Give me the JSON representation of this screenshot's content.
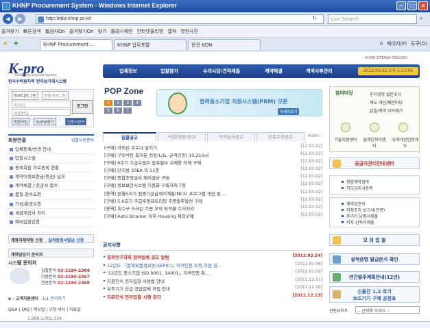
{
  "window": {
    "title": "KHNP Procurement System - Windows Internet Explorer"
  },
  "browser": {
    "url": "http://ebiz.khnp.co.kr/",
    "search_placeholder": "Live Search",
    "favorites": [
      "즐겨찾기",
      "빠른검색",
      "웹검사On",
      "즐겨찾기On",
      "찾기",
      "플래시제한",
      "인터넷올리빙",
      "캡쳐",
      "영한사전"
    ],
    "tabs": [
      "KHNP Procurement ...",
      "KHNP 업무포탈",
      "한전 KDN"
    ],
    "tools": [
      "페이지(P)",
      "도구(O)"
    ]
  },
  "header": {
    "logo": "K-pro",
    "logo_sub": "KHNP Procurement System",
    "logo_sub2": "한국수력원자력 전자상거래시스템",
    "top_links": "HOME  SITEMAP  ENGLISH",
    "gnb": [
      "업체정보",
      "입찰참가",
      "수의시담/견적제출",
      "계약체결",
      "계약사후관리"
    ],
    "clock": "2012.03.02  오후 5:57:06"
  },
  "login": {
    "tab_id": "아이디로그인",
    "tab_cert": "인증서로그인",
    "id_placeholder": "아이디",
    "pw_placeholder": "비밀번호",
    "login_button": "로그인",
    "member_join": "회원가입",
    "find_idpw": "ID/PW찾기",
    "cert_login": "인증서관리"
  },
  "quicklinks": {
    "title": "회원연결",
    "subtitle": "입찰사전준비",
    "items": [
      "업체등록/변경 안내",
      "입찰시스템",
      "등록회원 자료등록 현황",
      "계약이행보증금(증권) 납부",
      "계약체결 / 준공서 접수",
      "품질 검수요청",
      "기성/준공요청",
      "세금계산서 처리",
      "예비입찰신청"
    ]
  },
  "left_buttons": {
    "b1": "계좌이체약정 신청",
    "b1b": "실적증명서발급 신청",
    "b2": "계약담당자 문의처"
  },
  "contact": {
    "title": "시스템 문의처",
    "r1_label": "입찰문의",
    "r1_tel": "02-2194-2384",
    "r2_label": "이용문의",
    "r2_tel": "02-2194-2367",
    "r3_label": "전산문의",
    "r3_tel": "02-2194-2368",
    "center": "e - 고객지원센터",
    "center2": "1:1 문의하기",
    "faq": "Q&A | FAQ | 매뉴얼 | 규정·서식 | 자료실",
    "counts": "1,998     1,002,334"
  },
  "popzone": {
    "title": "POP Zone",
    "pages": [
      "1",
      "2",
      "3",
      "4",
      "5",
      "6",
      "7"
    ]
  },
  "banner": {
    "text": "협력중소기업 지원시스템(PRM) 오픈",
    "more": "자세히보기"
  },
  "content_tabs": [
    "입찰공고",
    "낙찰(예정)공고",
    "적격심사공고",
    "단독수의공고"
  ],
  "tenders": [
    {
      "t": "[구매] 자외선 포로나 발지기",
      "d": "[12.03.02]"
    },
    {
      "t": "[구매] 구미석탄 회처분 전동(L/G, 규격강종) 10,210㎥",
      "d": "[12.03.02]"
    },
    {
      "t": "[구매] 6호기 주급수펌프 압축밸브 교체용 자재 구매",
      "d": "[12.03.02]"
    },
    {
      "t": "[구매] 단지방 20EA 외 11종",
      "d": "[12.03.02]"
    },
    {
      "t": "[구매] 종합조정설비 제어설비 구매",
      "d": "[12.03.02]"
    },
    {
      "t": "[구매] 정보보안시스템 이중화 구축자재 7종",
      "d": "[12.03.02]"
    },
    {
      "t": "[용역] 원월5호기 원중기공급제어계통(NCS) 프로그램 개선 및 ...",
      "d": "[12.03.02]"
    },
    {
      "t": "[구매] 5,6호기 주급수펌프트리핑 주증발추발전 구매",
      "d": "[12.03.02]"
    },
    {
      "t": "[용역] 취수구 스크린 주변 부력 퇴적물 수거처리",
      "d": "[12.03.02]"
    },
    {
      "t": "[구매] Auto Strainer 하부 Housing 제작구매",
      "d": "[12.03.02]"
    }
  ],
  "notice": {
    "title": "공지사항",
    "items": [
      {
        "t": "정부연구과제 참여업체 공모 알림",
        "d": "[2012.02.24]",
        "style": "hl"
      },
      {
        "t": "12년도 「품재특품정보송(KEPIC)」자격인증 취득 지원 공...",
        "d": "[2012.02.06]",
        "style": "bl"
      },
      {
        "t": "'12년도 중소기업 ISO 9001, 14001」자격인증 취...",
        "d": "[2012.01.02]",
        "style": ""
      },
      {
        "t": "지문인식 전자입찰 사용법 안내",
        "d": "[2011.12.31]",
        "style": ""
      },
      {
        "t": "보조기기 선급 공급업체 모집 안내",
        "d": "[2011.12.20]",
        "style": ""
      },
      {
        "t": "지문인식 전자입찰 시행 공지",
        "d": "[2011.12.13]",
        "style": "hl"
      }
    ]
  },
  "right": {
    "box1_title": "참여마당",
    "box1_items": [
      "윤리경영 설문조사",
      "제도 개선/제안마당",
      "입찰/계약 이의제기"
    ],
    "icons": [
      "기술지원센터",
      "클레임처리센터",
      "유재개선인증제도"
    ],
    "supply_btn": "공급자관리안내센터",
    "gray1": [
      "청렴계약협약",
      "하도급지시항목"
    ],
    "gray2": [
      "계약업관리",
      "지정조치 보고서(관련)",
      "주기기 납품서제출",
      "외자 선적서제출"
    ],
    "mo_btn": "모 의 입 찰",
    "cert_btn": "실적증명 발급문서 확인",
    "year_btn": "연간발주계획안내(12년)",
    "new_btn1": "신울진 1,2 호기",
    "new_btn2": "보조기기 구매 공정표",
    "related": "관련사이트",
    "select": "-- 선택해 주세요 --"
  },
  "colors": {
    "navy": "#1c3e85",
    "accent": "#f2c83a",
    "red": "#c0302a"
  }
}
